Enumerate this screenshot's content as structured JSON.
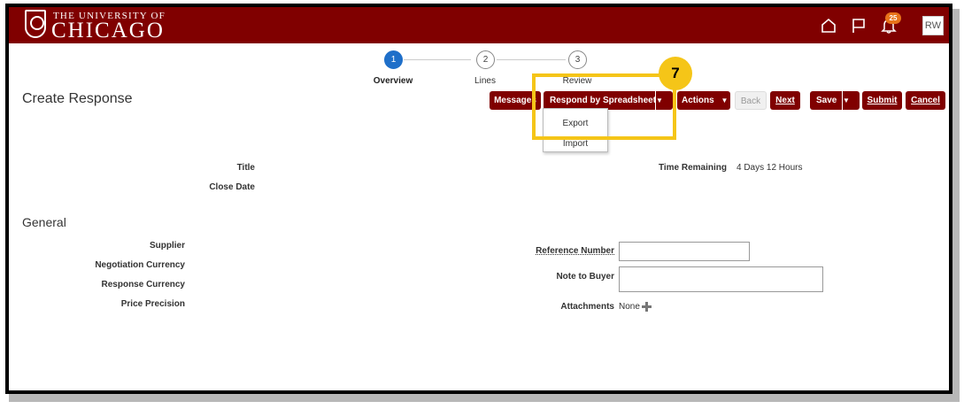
{
  "header": {
    "logo_line1": "THE UNIVERSITY OF",
    "logo_line2": "CHICAGO",
    "notifications_count": "25",
    "user_initials": "RW",
    "brand_color": "#800000"
  },
  "train": {
    "stops": [
      {
        "number": "1",
        "label": "Overview",
        "active": true
      },
      {
        "number": "2",
        "label": "Lines",
        "active": false
      },
      {
        "number": "3",
        "label": "Review",
        "active": false
      }
    ]
  },
  "page": {
    "title": "Create Response"
  },
  "toolbar": {
    "messages": "Messages",
    "respond_by_spreadsheet": "Respond by Spreadsheet",
    "actions": "Actions",
    "back": "Back",
    "next": "Next",
    "save": "Save",
    "submit": "Submit",
    "cancel": "Cancel"
  },
  "spreadsheet_menu": {
    "items": [
      "Export",
      "Import"
    ]
  },
  "callout": {
    "step_number": "7",
    "color": "#f5c518"
  },
  "summary": {
    "title_label": "Title",
    "close_date_label": "Close Date",
    "time_remaining_label": "Time Remaining",
    "time_remaining_value": "4 Days 12 Hours"
  },
  "general": {
    "heading": "General",
    "supplier_label": "Supplier",
    "negotiation_currency_label": "Negotiation Currency",
    "response_currency_label": "Response Currency",
    "price_precision_label": "Price Precision",
    "reference_number_label": "Reference Number",
    "reference_number_value": "",
    "note_to_buyer_label": "Note to Buyer",
    "note_to_buyer_value": "",
    "attachments_label": "Attachments",
    "attachments_value": "None"
  }
}
